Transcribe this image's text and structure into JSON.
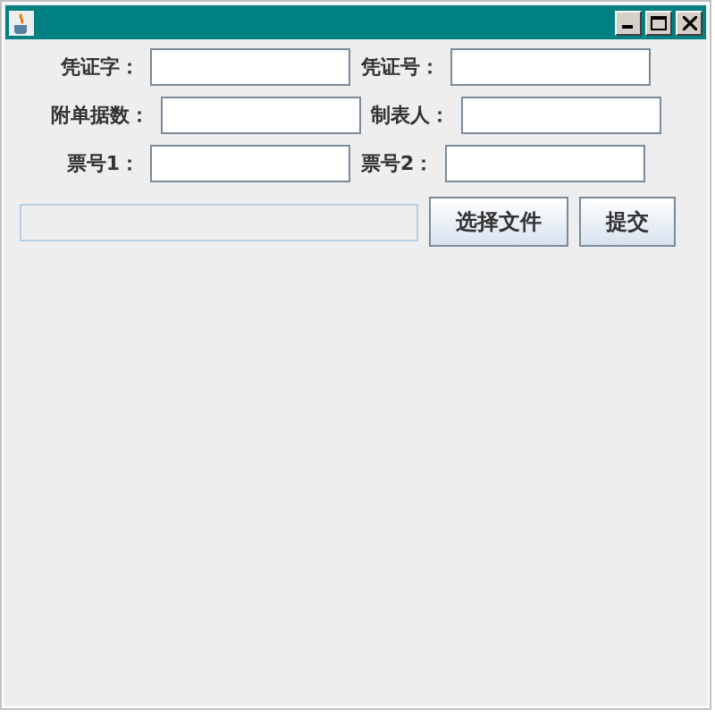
{
  "rows": [
    [
      {
        "label": "凭证字："
      },
      {
        "label": "凭证号："
      }
    ],
    [
      {
        "label": "附单据数："
      },
      {
        "label": "制表人："
      }
    ],
    [
      {
        "label": "票号1："
      },
      {
        "label": "票号2："
      }
    ]
  ],
  "buttons": [
    "选择文件",
    "提交"
  ]
}
